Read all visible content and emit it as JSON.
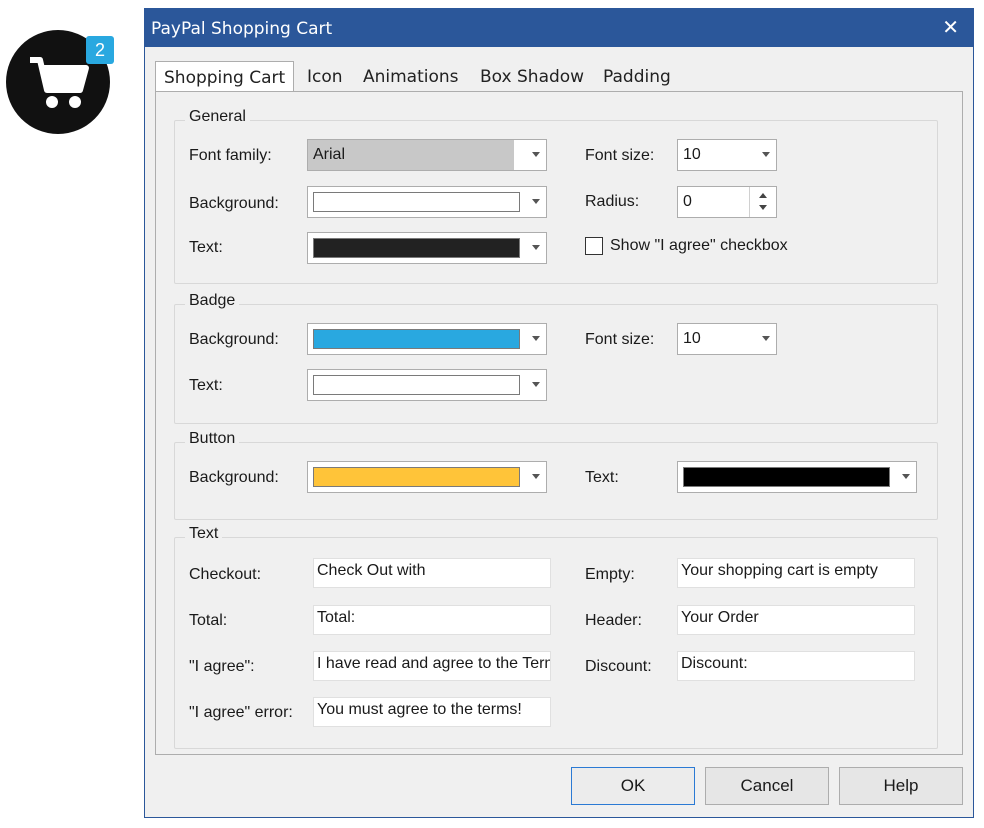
{
  "preview": {
    "badge_count": "2",
    "icon": "shopping-cart-icon",
    "circle_color": "#111111",
    "badge_color": "#29a8e0"
  },
  "window": {
    "title": "PayPal Shopping Cart",
    "close_glyph": "✕",
    "titlebar_color": "#2b579a"
  },
  "tabs": [
    {
      "label": "Shopping Cart",
      "active": true
    },
    {
      "label": "Icon"
    },
    {
      "label": "Animations"
    },
    {
      "label": "Box Shadow"
    },
    {
      "label": "Padding"
    }
  ],
  "general": {
    "title": "General",
    "font_family_label": "Font family:",
    "font_family_value": "Arial",
    "font_size_label": "Font size:",
    "font_size_value": "10",
    "background_label": "Background:",
    "background_color": "#ffffff",
    "radius_label": "Radius:",
    "radius_value": "0",
    "text_label": "Text:",
    "text_color": "#222222",
    "agree_checkbox_label": "Show \"I agree\" checkbox",
    "agree_checkbox_checked": false
  },
  "badge": {
    "title": "Badge",
    "background_label": "Background:",
    "background_color": "#29a8e0",
    "font_size_label": "Font size:",
    "font_size_value": "10",
    "text_label": "Text:",
    "text_color": "#ffffff"
  },
  "button": {
    "title": "Button",
    "background_label": "Background:",
    "background_color": "#ffc439",
    "text_label": "Text:",
    "text_color": "#000000"
  },
  "text": {
    "title": "Text",
    "checkout_label": "Checkout:",
    "checkout_value": "Check Out with",
    "empty_label": "Empty:",
    "empty_value": "Your shopping cart is empty",
    "total_label": "Total:",
    "total_value": "Total:",
    "header_label": "Header:",
    "header_value": "Your Order",
    "agree_label": "\"I agree\":",
    "agree_value": "I have read and agree to the Terms",
    "discount_label": "Discount:",
    "discount_value": "Discount:",
    "agree_error_label": "\"I agree\" error:",
    "agree_error_value": "You must agree to the terms!"
  },
  "buttons": {
    "ok": "OK",
    "cancel": "Cancel",
    "help": "Help"
  }
}
